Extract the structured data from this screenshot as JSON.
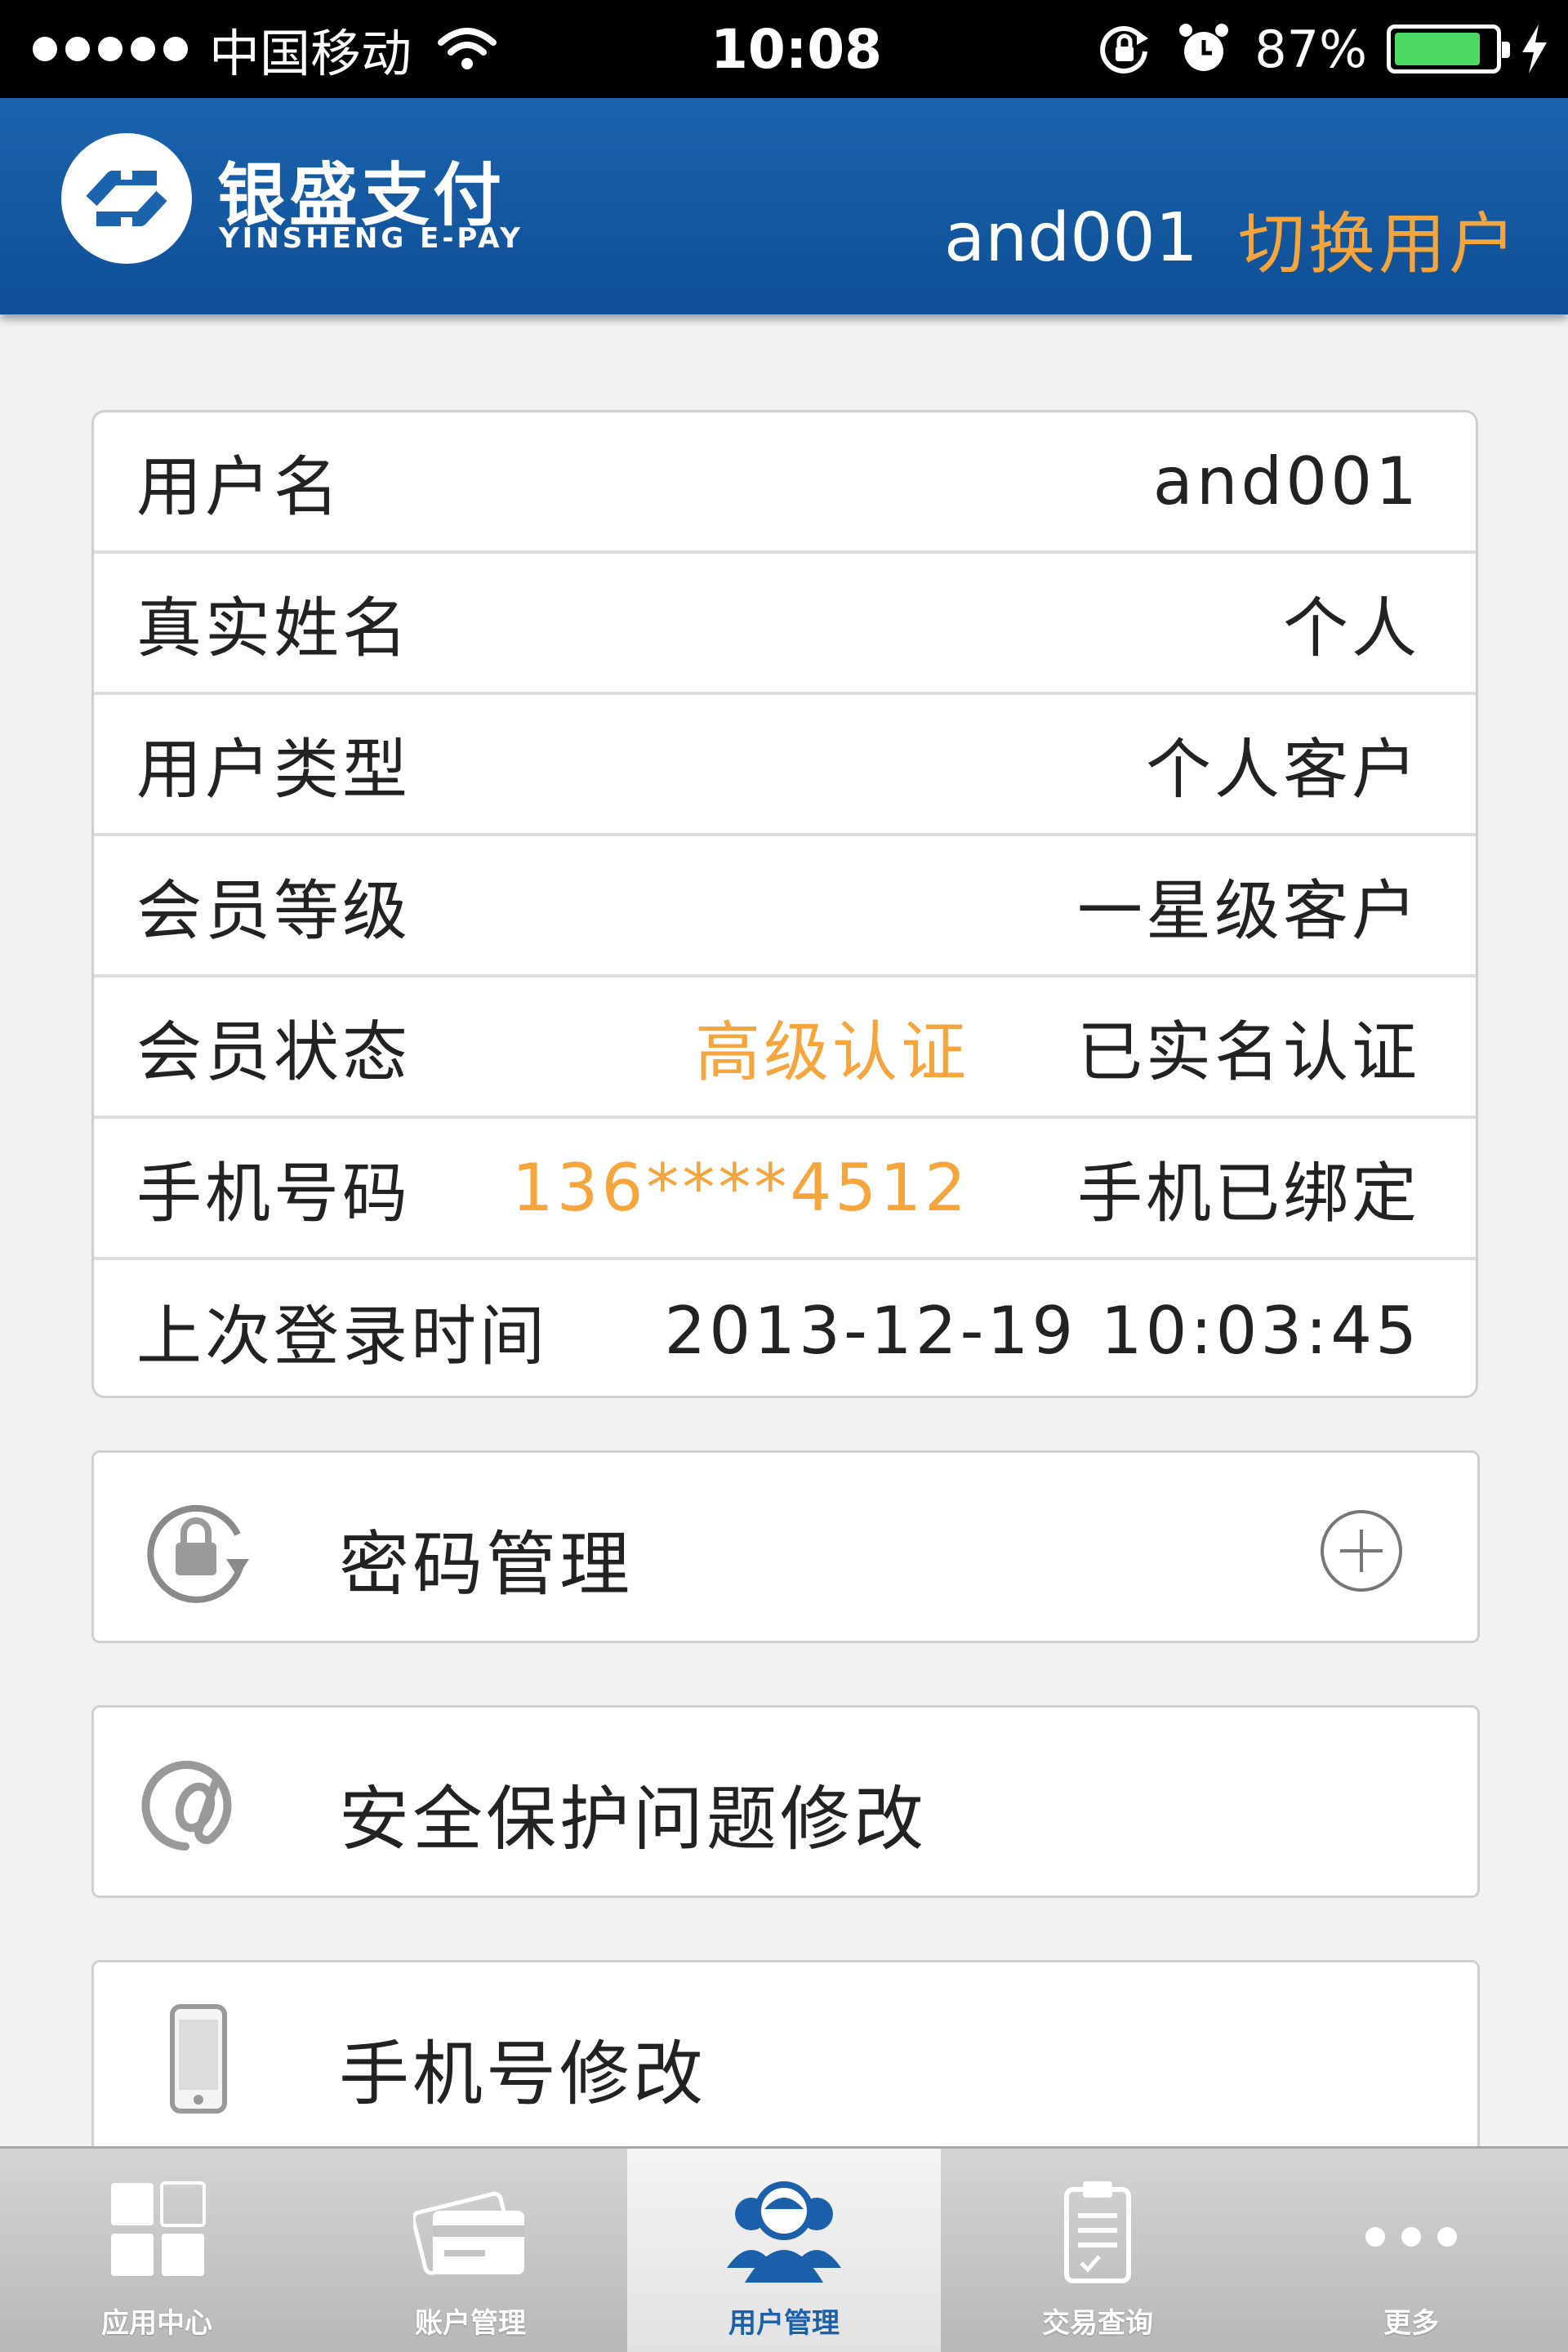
{
  "status_bar": {
    "carrier": "中国移动",
    "time": "10:08",
    "battery_percent": "87%",
    "battery_level": 0.87,
    "icons": [
      "signal-dots-icon",
      "wifi-icon",
      "rotation-lock-icon",
      "alarm-icon",
      "battery-icon",
      "charging-bolt-icon"
    ]
  },
  "header": {
    "logo_cn": "银盛支付",
    "logo_en": "YINSHENG E-PAY",
    "username": "and001",
    "switch_user": "切换用户",
    "brand_color": "#1b63ad",
    "accent_color": "#f5a53c"
  },
  "user_info": {
    "rows": [
      {
        "label": "用户名",
        "value": "and001"
      },
      {
        "label": "真实姓名",
        "value": "个人"
      },
      {
        "label": "用户类型",
        "value": "个人客户"
      },
      {
        "label": "会员等级",
        "value": "一星级客户"
      },
      {
        "label": "会员状态",
        "tag": "高级认证",
        "value": "已实名认证"
      },
      {
        "label": "手机号码",
        "tag": "136****4512",
        "value": "手机已绑定"
      },
      {
        "label": "上次登录时间",
        "value": "2013-12-19 10:03:45"
      }
    ]
  },
  "actions": [
    {
      "label": "密码管理",
      "icon": "lock-rotate-icon"
    },
    {
      "label": "安全保护问题修改",
      "icon": "at-sign-icon"
    },
    {
      "label": "手机号修改",
      "icon": "mobile-phone-icon"
    }
  ],
  "tab_bar": {
    "tabs": [
      {
        "label": "应用中心",
        "icon": "app-grid-icon"
      },
      {
        "label": "账户管理",
        "icon": "bank-card-icon"
      },
      {
        "label": "用户管理",
        "icon": "users-icon",
        "active": true
      },
      {
        "label": "交易查询",
        "icon": "clipboard-icon"
      },
      {
        "label": "更多",
        "icon": "more-dots-icon"
      }
    ]
  }
}
